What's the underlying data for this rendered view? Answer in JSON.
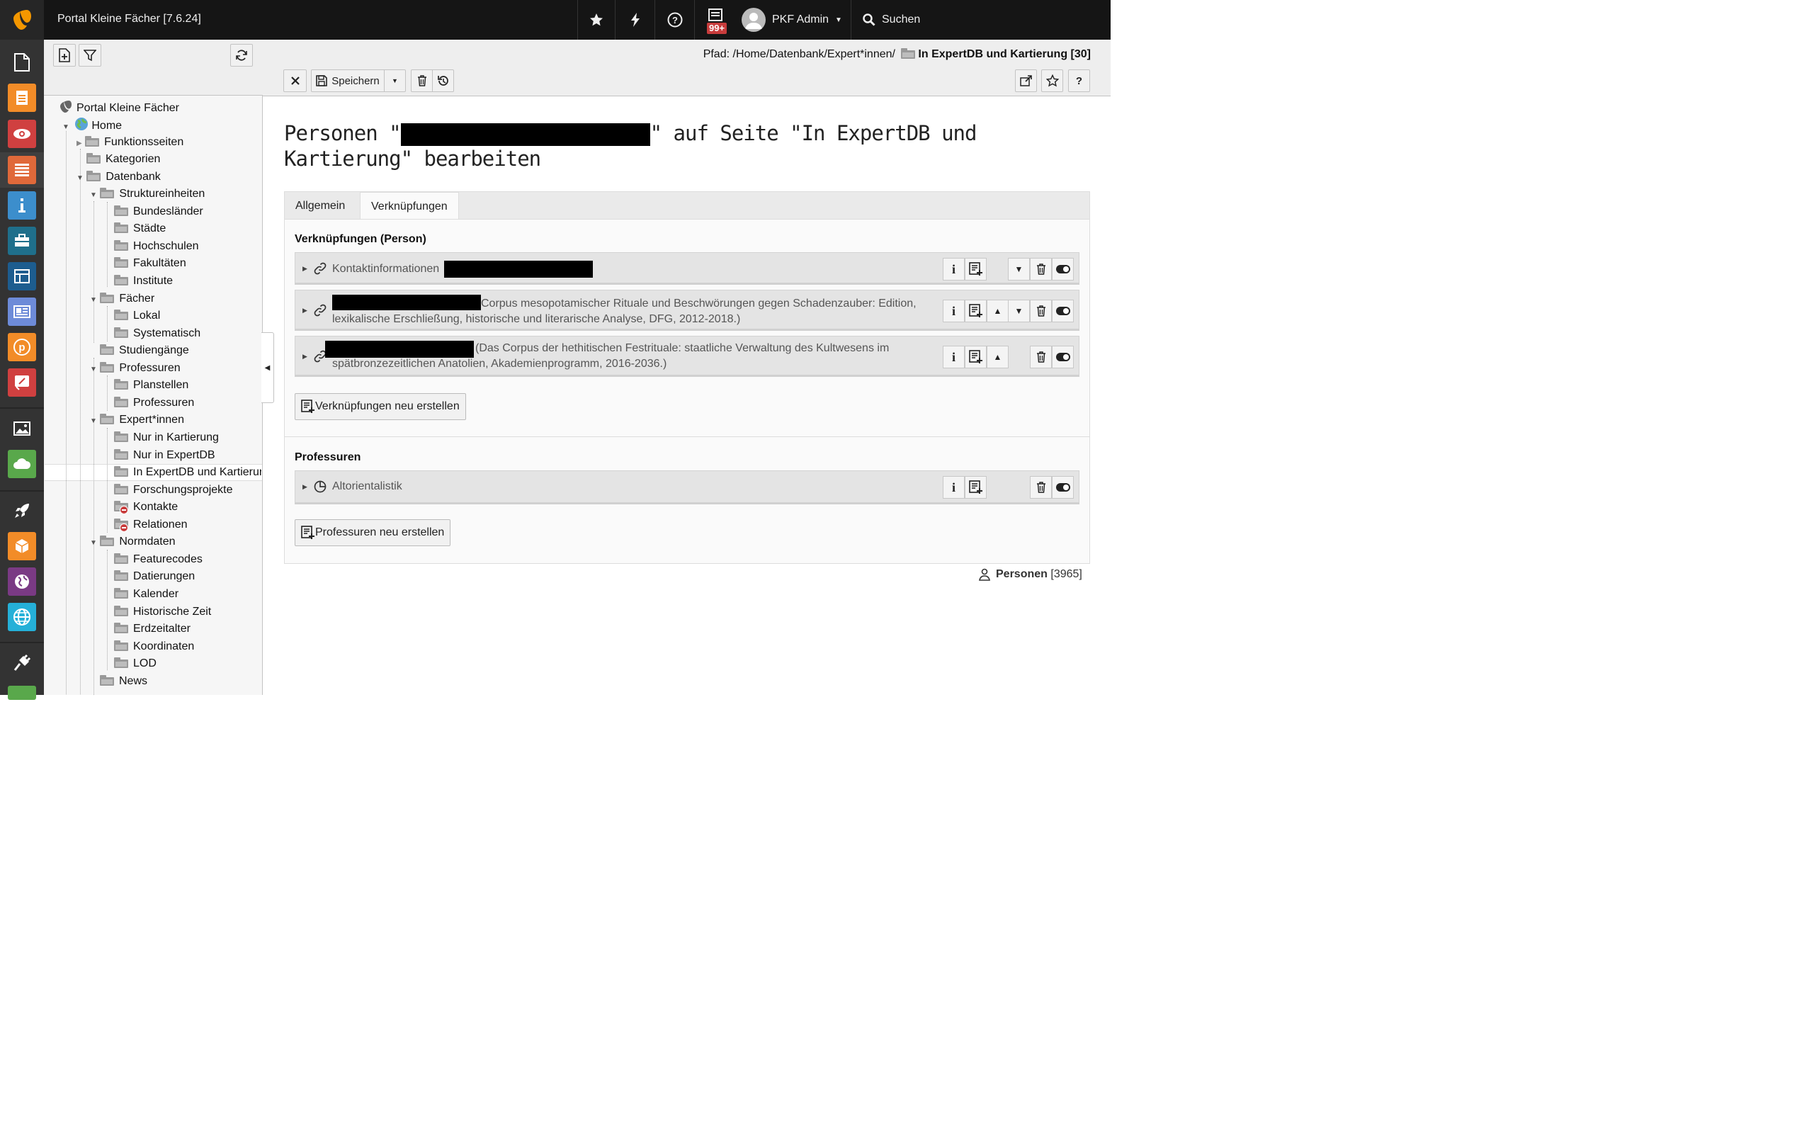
{
  "topbar": {
    "site_title": "Portal Kleine Fächer [7.6.24]",
    "notification_badge": "99+",
    "user_name": "PKF Admin",
    "search_label": "Suchen"
  },
  "tree": {
    "nodes": [
      {
        "label": "Portal Kleine Fächer"
      },
      {
        "label": "Home"
      },
      {
        "label": "Funktionsseiten"
      },
      {
        "label": "Kategorien"
      },
      {
        "label": "Datenbank"
      },
      {
        "label": "Struktureinheiten"
      },
      {
        "label": "Bundesländer"
      },
      {
        "label": "Städte"
      },
      {
        "label": "Hochschulen"
      },
      {
        "label": "Fakultäten"
      },
      {
        "label": "Institute"
      },
      {
        "label": "Fächer"
      },
      {
        "label": "Lokal"
      },
      {
        "label": "Systematisch"
      },
      {
        "label": "Studiengänge"
      },
      {
        "label": "Professuren"
      },
      {
        "label": "Planstellen"
      },
      {
        "label": "Professuren"
      },
      {
        "label": "Expert*innen"
      },
      {
        "label": "Nur in Kartierung"
      },
      {
        "label": "Nur in ExpertDB"
      },
      {
        "label": "In ExpertDB und Kartierung"
      },
      {
        "label": "Forschungsprojekte"
      },
      {
        "label": "Kontakte"
      },
      {
        "label": "Relationen"
      },
      {
        "label": "Normdaten"
      },
      {
        "label": "Featurecodes"
      },
      {
        "label": "Datierungen"
      },
      {
        "label": "Kalender"
      },
      {
        "label": "Historische Zeit"
      },
      {
        "label": "Erdzeitalter"
      },
      {
        "label": "Koordinaten"
      },
      {
        "label": "LOD"
      },
      {
        "label": "News"
      }
    ]
  },
  "docheader": {
    "path_prefix": "Pfad: /Home/Datenbank/Expert*innen/",
    "path_page": "In ExpertDB und Kartierung [30]",
    "save_label": "Speichern"
  },
  "main": {
    "heading_prefix": "Personen \"",
    "heading_suffix": "\" auf Seite \"In ExpertDB und Kartierung\" bearbeiten",
    "tabs": [
      {
        "label": "Allgemein"
      },
      {
        "label": "Verknüpfungen"
      }
    ],
    "section1_title": "Verknüpfungen (Person)",
    "relations": [
      {
        "label": "Kontaktinformationen"
      },
      {
        "label": "Corpus mesopotamischer Rituale und Beschwörungen gegen Schadenzauber: Edition, lexikalische Erschließung, historische und literarische Analyse, DFG, 2012-2018.)"
      },
      {
        "label": "(Das Corpus der hethitischen Festrituale: staatliche Verwaltung des Kultwesens im spätbronzezeitlichen Anatolien, Akademienprogramm, 2016-2036.)"
      }
    ],
    "new_relation_label": "Verknüpfungen neu erstellen",
    "section2_title": "Professuren",
    "professur": {
      "label": "Altorientalistik"
    },
    "new_professur_label": "Professuren neu erstellen",
    "footer_table": "Personen",
    "footer_uid": "[3965]"
  }
}
